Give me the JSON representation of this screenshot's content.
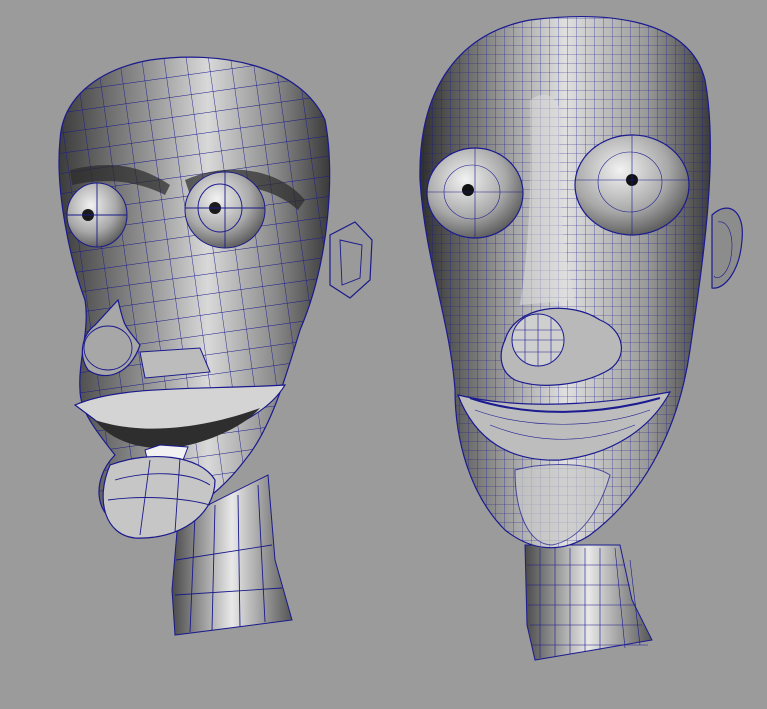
{
  "scene": {
    "background_color": "#9b9b9b",
    "mesh_fill_light": "#d8d8d8",
    "mesh_fill_dark": "#4a4a4a",
    "wireframe_color": "#1a1a8c"
  },
  "models": [
    {
      "id": "low-poly-head",
      "description_name": "low-poly-head-model"
    },
    {
      "id": "high-poly-head",
      "description_name": "subdivided-head-model"
    }
  ]
}
